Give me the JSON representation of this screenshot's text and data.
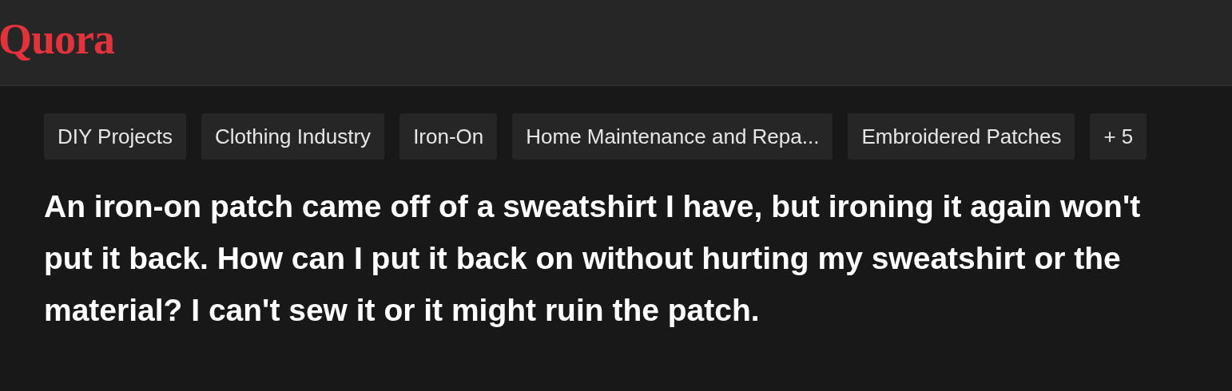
{
  "header": {
    "logo": "Quora"
  },
  "topics": [
    {
      "label": "DIY Projects"
    },
    {
      "label": "Clothing Industry"
    },
    {
      "label": "Iron-On"
    },
    {
      "label": "Home Maintenance and Repa..."
    },
    {
      "label": "Embroidered Patches"
    },
    {
      "label": "+ 5"
    }
  ],
  "question": "An iron-on patch came off of a sweatshirt I have, but ironing it again won't put it back. How can I put it back on without hurting my sweatshirt or the material? I can't sew it or it might ruin the patch."
}
